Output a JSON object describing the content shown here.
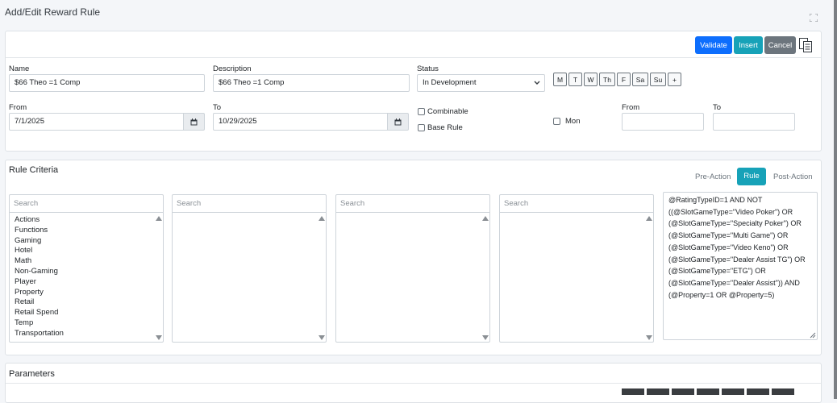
{
  "header": {
    "title": "Add/Edit Reward Rule"
  },
  "toolbar": {
    "validate": "Validate",
    "insert": "Insert",
    "cancel": "Cancel"
  },
  "form": {
    "name_label": "Name",
    "name_value": "$66 Theo =1 Comp",
    "desc_label": "Description",
    "desc_value": "$66 Theo =1 Comp",
    "status_label": "Status",
    "status_value": "In Development",
    "days": [
      "M",
      "T",
      "W",
      "Th",
      "F",
      "Sa",
      "Su",
      "+"
    ],
    "from_label": "From",
    "from_value": "7/1/2025",
    "to_label": "To",
    "to_value": "10/29/2025",
    "combinable_label": "Combinable",
    "base_rule_label": "Base Rule",
    "mon_label": "Mon",
    "from2_label": "From",
    "to2_label": "To"
  },
  "criteria": {
    "title": "Rule Criteria",
    "tabs": [
      "Pre-Action",
      "Rule",
      "Post-Action"
    ],
    "active_tab": "Rule",
    "search_placeholder": "Search",
    "categories": [
      "Actions",
      "Functions",
      "Gaming",
      "Hotel",
      "Math",
      "Non-Gaming",
      "Player",
      "Property",
      "Retail",
      "Retail Spend",
      "Temp",
      "Transportation"
    ],
    "expression": " @RatingTypeID=1  AND NOT\n((@SlotGameType=\"Video Poker\") OR\n(@SlotGameType=\"Specialty Poker\") OR\n(@SlotGameType=\"Multi Game\") OR\n(@SlotGameType=\"Video Keno\") OR\n(@SlotGameType=\"Dealer Assist TG\") OR\n(@SlotGameType=\"ETG\")  OR\n(@SlotGameType=\"Dealer Assist\")) AND\n(@Property=1  OR  @Property=5)"
  },
  "parameters": {
    "title": "Parameters"
  },
  "icons": {
    "expand": "expand-icon",
    "calendar": "calendar-icon",
    "copy": "copy-icon"
  },
  "colors": {
    "primary": "#0d6efd",
    "teal": "#17a2b8",
    "secondary": "#6c757d"
  }
}
